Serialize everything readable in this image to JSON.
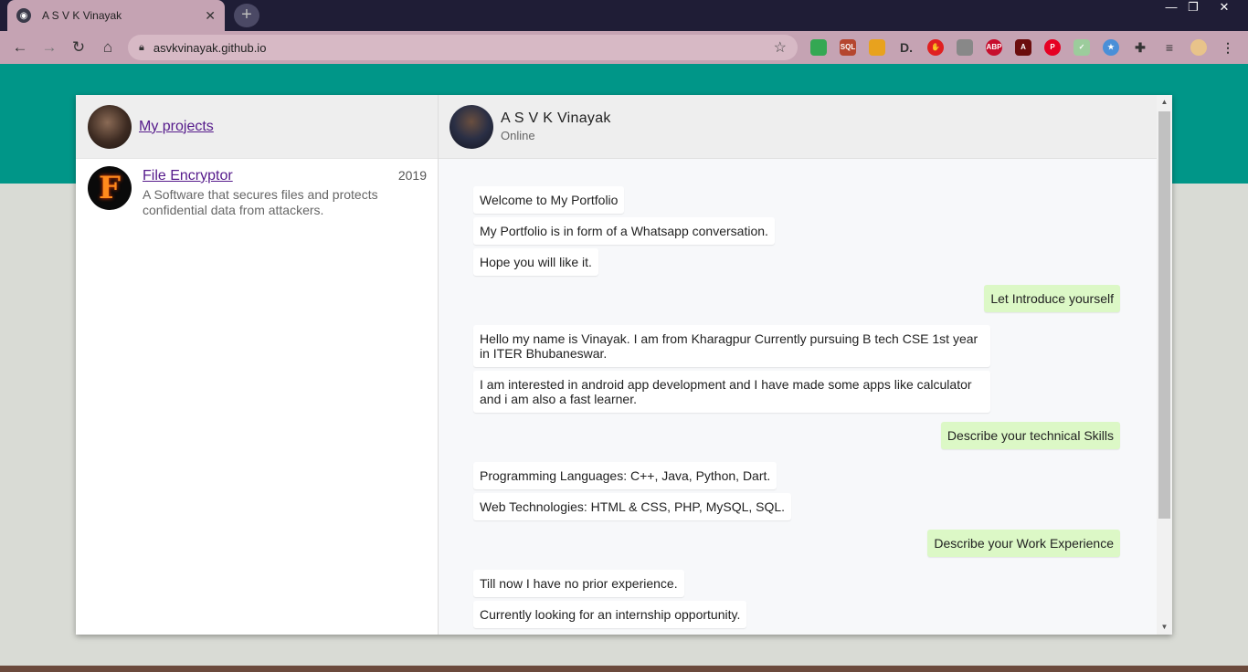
{
  "browser": {
    "tab_title": "A S V K Vinayak",
    "tab_close": "✕",
    "new_tab": "+",
    "url": "asvkvinayak.github.io",
    "window_controls": {
      "minimize": "—",
      "restore": "❐",
      "close": "✕"
    },
    "extensions": [
      {
        "name": "google-drive-icon",
        "color": "#34a853",
        "label": ""
      },
      {
        "name": "sql-extension-icon",
        "color": "#b5462f",
        "label": "SQL"
      },
      {
        "name": "color-grid-icon",
        "color": "#e8a21e",
        "label": ""
      },
      {
        "name": "d-extension-icon",
        "color": "#333333",
        "label": "D."
      },
      {
        "name": "red-hand-icon",
        "color": "#e02020",
        "label": "✋"
      },
      {
        "name": "grey-drive-icon",
        "color": "#888888",
        "label": ""
      },
      {
        "name": "adblock-plus-icon",
        "color": "#c70d2c",
        "label": "ABP"
      },
      {
        "name": "pdf-icon",
        "color": "#6b0d0d",
        "label": "A"
      },
      {
        "name": "pinterest-icon",
        "color": "#e60023",
        "label": "P"
      },
      {
        "name": "checklist-icon",
        "color": "#9ccc9c",
        "label": "✓"
      },
      {
        "name": "star-badge-icon",
        "color": "#4a8fd8",
        "label": "★"
      },
      {
        "name": "puzzle-extensions-icon",
        "color": "#333333",
        "label": "✚"
      },
      {
        "name": "reading-list-icon",
        "color": "#333333",
        "label": "≡"
      },
      {
        "name": "profile-avatar-icon",
        "color": "#e8c38a",
        "label": ""
      },
      {
        "name": "menu-kebab-icon",
        "color": "#333333",
        "label": "⋮"
      }
    ]
  },
  "sidebar": {
    "header_link": "My projects",
    "projects": [
      {
        "name": "File Encryptor",
        "year": "2019",
        "description": "A Software that secures files and protects confidential data from attackers.",
        "avatar_letter": "F"
      }
    ]
  },
  "chat": {
    "name": "A S V K Vinayak",
    "status": "Online",
    "messages": [
      {
        "dir": "in",
        "text": "Welcome to My Portfolio"
      },
      {
        "dir": "in",
        "text": "My Portfolio is in form of a Whatsapp conversation."
      },
      {
        "dir": "in",
        "text": "Hope you will like it."
      },
      {
        "dir": "out",
        "text": "Let Introduce yourself"
      },
      {
        "dir": "in",
        "text": "Hello my name is Vinayak. I am from Kharagpur Currently pursuing B tech CSE 1st year in ITER Bhubaneswar."
      },
      {
        "dir": "in",
        "text": "I am interested in android app development and I have made some apps like calculator and i am also a fast learner."
      },
      {
        "dir": "out",
        "text": "Describe your technical Skills"
      },
      {
        "dir": "in",
        "text": "Programming Languages: C++, Java, Python, Dart."
      },
      {
        "dir": "in",
        "text": "Web Technologies: HTML & CSS, PHP, MySQL, SQL."
      },
      {
        "dir": "out",
        "text": "Describe your Work Experience"
      },
      {
        "dir": "in",
        "text": "Till now I have no prior experience."
      },
      {
        "dir": "in",
        "text": "Currently looking for an internship opportunity."
      }
    ]
  },
  "colors": {
    "header_band": "#009688",
    "outgoing_bubble": "#dcf8c6",
    "incoming_bubble": "#ffffff",
    "chrome_theme": "#c5a3b3"
  }
}
